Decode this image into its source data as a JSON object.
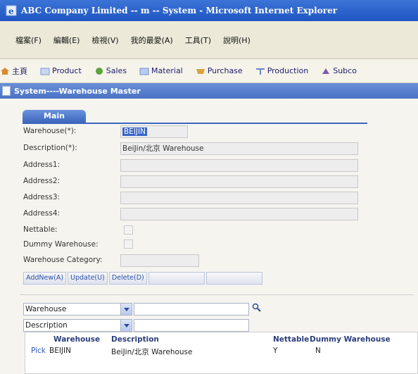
{
  "window": {
    "title": "ABC Company Limited -- m -- System - Microsoft Internet Explorer"
  },
  "menubar": {
    "items": [
      "檔案(F)",
      "編輯(E)",
      "檢視(V)",
      "我的最愛(A)",
      "工具(T)",
      "說明(H)"
    ]
  },
  "modules": {
    "items": [
      {
        "label": "主頁",
        "icon": "home-icon"
      },
      {
        "label": "Product",
        "icon": "product-icon"
      },
      {
        "label": "Sales",
        "icon": "sales-icon"
      },
      {
        "label": "Material",
        "icon": "material-icon"
      },
      {
        "label": "Purchase",
        "icon": "purchase-icon"
      },
      {
        "label": "Production",
        "icon": "production-icon"
      },
      {
        "label": "Subco",
        "icon": "subcontract-icon"
      }
    ]
  },
  "page": {
    "header": "System----Warehouse Master",
    "tab": "Main"
  },
  "form": {
    "warehouse_label": "Warehouse(*):",
    "warehouse_value": "BEIJIN",
    "description_label": "Description(*):",
    "description_value": "BeiJin/北京 Warehouse",
    "address1_label": "Address1:",
    "address2_label": "Address2:",
    "address3_label": "Address3:",
    "address4_label": "Address4:",
    "nettable_label": "Nettable:",
    "dummy_label": "Dummy Warehouse:",
    "category_label": "Warehouse Category:"
  },
  "buttons": {
    "addnew": "AddNew(A)",
    "update": "Update(U)",
    "delete": "Delete(D)"
  },
  "filters": [
    {
      "field": "Warehouse",
      "value": ""
    },
    {
      "field": "Description",
      "value": ""
    }
  ],
  "grid": {
    "columns": [
      "Warehouse",
      "Description",
      "Nettable",
      "Dummy Warehouse"
    ],
    "rows": [
      {
        "action": "Pick",
        "warehouse": "BEIJIN",
        "description": "BeiJin/北京 Warehouse",
        "nettable": "Y",
        "dummy": "N"
      }
    ]
  },
  "colors": {
    "titlebar": "#1f55c2",
    "accent": "#3d66bd",
    "link": "#2a55b8"
  }
}
